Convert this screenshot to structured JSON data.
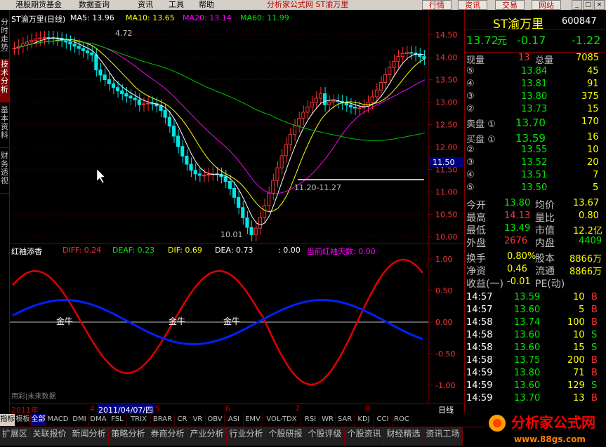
{
  "menubar": {
    "items": [
      "港股期货基金",
      "数据查询",
      "资讯",
      "工具",
      "帮助"
    ],
    "title": "分析家公式网  ST渝万里",
    "buttons": [
      "行情",
      "资讯",
      "交易",
      "网站"
    ]
  },
  "left_tabs": [
    "分时走势",
    "技术分析",
    "基本资料",
    "财务透视"
  ],
  "main": {
    "title": "ST渝万里(日线)",
    "ma5": "MA5: 13.96",
    "ma10": "MA10: 13.65",
    "ma20": "MA20: 13.14",
    "ma60": "MA60: 11.99",
    "high_label": "4.72",
    "low_label": "10.01",
    "range_label": "11.20-11.27",
    "price_box": "11.50",
    "y_ticks": [
      "14.50",
      "14.00",
      "13.50",
      "13.00",
      "12.50",
      "12.00",
      "11.50",
      "11.00",
      "10.50",
      "10.00"
    ]
  },
  "sub": {
    "title": "红袖添香",
    "diff": "DIFF: 0.24",
    "deaf": "DEAF: 0.23",
    "dif": "DIF: 0.69",
    "dea": "DEA: 0.73",
    "extra": ": 0.00",
    "days": "当前红袖天数: 0.00",
    "y_ticks": [
      "1.00",
      "0.50",
      "0.00",
      "-0.50",
      "-1.00"
    ],
    "labels": [
      "金牛",
      "金牛",
      "金牛"
    ],
    "footer": "用彩|未来数据"
  },
  "time_axis": {
    "year": "2011年",
    "m4": "4",
    "date": "2011/04/07/四",
    "m5": "5",
    "m6": "6",
    "m7": "7",
    "m8": "8",
    "period": "日线"
  },
  "right_panel": {
    "name": "ST渝万里",
    "code": "600847",
    "price": "13.72",
    "unit": "元",
    "change": "-0.17",
    "pct": "-1.22",
    "now_label": "现量",
    "now_val": "13",
    "total_label": "总量",
    "total_val": "7085",
    "asks": [
      {
        "lvl": "⑤",
        "price": "13.84",
        "vol": "45"
      },
      {
        "lvl": "④",
        "price": "13.81",
        "vol": "91"
      },
      {
        "lvl": "③",
        "price": "13.80",
        "vol": "375"
      },
      {
        "lvl": "②",
        "price": "13.73",
        "vol": "15"
      },
      {
        "lvl": "卖盘 ①",
        "price": "13.70",
        "vol": "170"
      }
    ],
    "bids": [
      {
        "lvl": "买盘 ①",
        "price": "13.59",
        "vol": "16"
      },
      {
        "lvl": "②",
        "price": "13.55",
        "vol": "10"
      },
      {
        "lvl": "③",
        "price": "13.52",
        "vol": "20"
      },
      {
        "lvl": "④",
        "price": "13.51",
        "vol": "7"
      },
      {
        "lvl": "⑤",
        "price": "13.50",
        "vol": "5"
      }
    ],
    "stats": [
      {
        "l1": "今开",
        "v1": "13.80",
        "l2": "均价",
        "v2": "13.67"
      },
      {
        "l1": "最高",
        "v1": "14.13",
        "l2": "量比",
        "v2": "0.80"
      },
      {
        "l1": "最低",
        "v1": "13.49",
        "l2": "市值",
        "v2": "12.2亿"
      },
      {
        "l1": "外盘",
        "v1": "2676",
        "l2": "内盘",
        "v2": "4409"
      }
    ],
    "stats2": [
      {
        "l1": "换手",
        "v1": "0.80%",
        "l2": "股本",
        "v2": "8866万"
      },
      {
        "l1": "净资",
        "v1": "0.46",
        "l2": "流通",
        "v2": "8866万"
      },
      {
        "l1": "收益(一)",
        "v1": "-0.01",
        "l2": "PE(动)",
        "v2": ""
      }
    ],
    "ticks": [
      {
        "t": "14:57",
        "p": "13.59",
        "v": "10",
        "s": "B"
      },
      {
        "t": "14:57",
        "p": "13.60",
        "v": "5",
        "s": "B"
      },
      {
        "t": "14:58",
        "p": "13.74",
        "v": "100",
        "s": "B"
      },
      {
        "t": "14:58",
        "p": "13.60",
        "v": "10",
        "s": "S"
      },
      {
        "t": "14:58",
        "p": "13.60",
        "v": "15",
        "s": "S"
      },
      {
        "t": "14:58",
        "p": "13.75",
        "v": "200",
        "s": "B"
      },
      {
        "t": "14:59",
        "p": "13.80",
        "v": "71",
        "s": "B"
      },
      {
        "t": "14:59",
        "p": "13.60",
        "v": "129",
        "s": "S"
      },
      {
        "t": "14:59",
        "p": "13.70",
        "v": "13",
        "s": "B"
      }
    ]
  },
  "indicator_tabs": [
    "指标",
    "模板",
    "全部",
    "MACD",
    "DMI",
    "DMA",
    "FSL",
    "TRIX",
    "BRAR",
    "CR",
    "VR",
    "OBV",
    "ASI",
    "EMV",
    "VOL-TDX",
    "RSI",
    "WR",
    "SAR",
    "KDJ",
    "CCI",
    "ROC"
  ],
  "bottom_bar": [
    "扩展区",
    "关联报价",
    "新闻分析",
    "策略分析",
    "券商分析",
    "产业分析",
    "行业分析",
    "个股研报",
    "个股评级",
    "个股资讯",
    "财经精选",
    "资讯工场"
  ],
  "logo": {
    "text": "分析家公式网",
    "url": "www.88gs.com"
  },
  "colors": {
    "up": "#ff3232",
    "down": "#00e6e6",
    "ma5": "#ffffff",
    "ma10": "#ffff00",
    "ma20": "#ff00ff",
    "ma60": "#00c000"
  }
}
